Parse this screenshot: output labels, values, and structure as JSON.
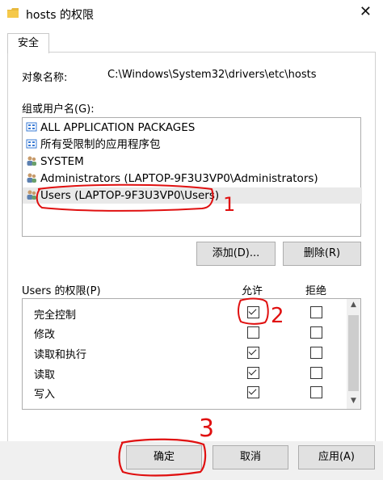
{
  "window": {
    "title": "hosts 的权限",
    "close_glyph": "✕"
  },
  "tabs": [
    {
      "label": "安全"
    }
  ],
  "object": {
    "label": "对象名称:",
    "value": "C:\\Windows\\System32\\drivers\\etc\\hosts"
  },
  "groups": {
    "label": "组或用户名(G):",
    "items": [
      {
        "label": "ALL APPLICATION PACKAGES",
        "icon": "app-package-icon"
      },
      {
        "label": "所有受限制的应用程序包",
        "icon": "app-package-icon"
      },
      {
        "label": "SYSTEM",
        "icon": "users-icon"
      },
      {
        "label": "Administrators (LAPTOP-9F3U3VP0\\Administrators)",
        "icon": "users-icon"
      },
      {
        "label": "Users (LAPTOP-9F3U3VP0\\Users)",
        "icon": "users-icon",
        "selected": true
      }
    ],
    "add_label": "添加(D)...",
    "remove_label": "删除(R)"
  },
  "permissions": {
    "label": "Users 的权限(P)",
    "allow_header": "允许",
    "deny_header": "拒绝",
    "rows": [
      {
        "name": "完全控制",
        "allow": true,
        "deny": false
      },
      {
        "name": "修改",
        "allow": false,
        "deny": false
      },
      {
        "name": "读取和执行",
        "allow": true,
        "deny": false
      },
      {
        "name": "读取",
        "allow": true,
        "deny": false
      },
      {
        "name": "写入",
        "allow": true,
        "deny": false
      }
    ]
  },
  "buttons": {
    "ok": "确定",
    "cancel": "取消",
    "apply": "应用(A)"
  },
  "annotations": {
    "one": "1",
    "two": "2",
    "three": "3",
    "color": "#e01010"
  }
}
